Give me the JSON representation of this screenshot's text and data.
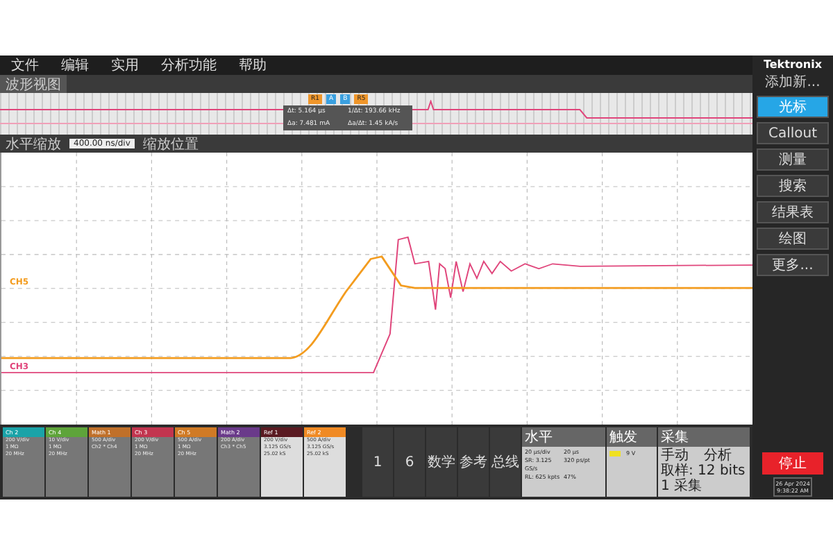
{
  "menu": [
    "文件",
    "编辑",
    "实用",
    "分析功能",
    "帮助"
  ],
  "brand": "Tektronix",
  "overview": {
    "title": "波形视图",
    "markers": [
      "R1",
      "A",
      "B",
      "R5"
    ]
  },
  "cursor_readout": [
    "Δt: 5.164 µs",
    "1/Δt: 193.66 kHz",
    "Δa: 7.481 mA",
    "Δa/Δt: 1.45 kA/s"
  ],
  "zoom_bar": [
    "水平缩放",
    "400.00 ns/div",
    "缩放位置"
  ],
  "trace_labels": [
    {
      "label": "CH5",
      "color": "#f39c1f"
    },
    {
      "label": "CH3",
      "color": "#e0457b"
    }
  ],
  "side_panel": {
    "title": "添加新...",
    "buttons": [
      {
        "label": "光标",
        "selected": true
      },
      {
        "label": "Callout",
        "selected": false
      },
      {
        "label": "测量",
        "selected": false
      },
      {
        "label": "搜索",
        "selected": false
      },
      {
        "label": "结果表",
        "selected": false
      },
      {
        "label": "绘图",
        "selected": false
      },
      {
        "label": "更多...",
        "selected": false
      }
    ]
  },
  "channels": [
    {
      "name": "Ch 2",
      "color": "#1aa3a8",
      "lines": [
        "200 V/div",
        "1 MΩ",
        "20 MHz"
      ]
    },
    {
      "name": "Ch 4",
      "color": "#5ea43a",
      "lines": [
        "10 V/div",
        "1 MΩ",
        "20 MHz"
      ]
    },
    {
      "name": "Math 1",
      "color": "#c0702a",
      "lines": [
        "500 A/div",
        "Ch2 * Ch4"
      ]
    },
    {
      "name": "Ch 3",
      "color": "#c2354f",
      "lines": [
        "200 V/div",
        "1 MΩ",
        "20 MHz"
      ]
    },
    {
      "name": "Ch 5",
      "color": "#d07a25",
      "lines": [
        "500 A/div",
        "1 MΩ",
        "20 MHz"
      ]
    },
    {
      "name": "Math 2",
      "color": "#6a3a8a",
      "lines": [
        "200 A/div",
        "Ch3 * Ch5"
      ]
    },
    {
      "name": "Ref 1",
      "color": "#5a1a22",
      "lines": [
        "200 V/div",
        "3.125 GS/s",
        "25.02 kS"
      ]
    },
    {
      "name": "Ref 2",
      "color": "#f08a24",
      "lines": [
        "500 A/div",
        "3.125 GS/s",
        "25.02 kS"
      ]
    }
  ],
  "add_buttons": [
    "1",
    "6",
    "数学",
    "参考",
    "总线"
  ],
  "horizontal": {
    "title": "水平",
    "lines": [
      "20 µs/div",
      "20 µs",
      "SR: 3.125 GS/s",
      "320 ps/pt",
      "RL: 625 kpts",
      "47%"
    ]
  },
  "trigger": {
    "title": "触发",
    "level": "9 V"
  },
  "acquisition": {
    "title": "采集",
    "lines": [
      "手动",
      "分析",
      "取样: 12 bits",
      "1 采集"
    ]
  },
  "run_button": "停止",
  "date": "26 Apr 2024",
  "time": "9:38:22 AM"
}
